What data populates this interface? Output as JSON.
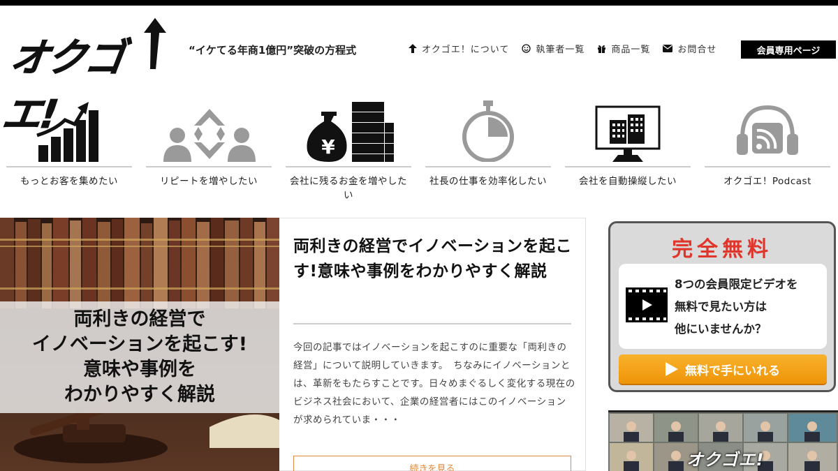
{
  "brand": {
    "logo_text": "オクゴエ!",
    "tagline": "“イケてる年商1億円”突破の方程式"
  },
  "nav": {
    "items": [
      {
        "label": "オクゴエ！について",
        "icon": "arrow-up-icon"
      },
      {
        "label": "執筆者一覧",
        "icon": "smile-icon"
      },
      {
        "label": "商品一覧",
        "icon": "gift-icon"
      },
      {
        "label": "お問合せ",
        "icon": "envelope-icon"
      }
    ],
    "member_button": "会員専用ページ"
  },
  "categories": [
    {
      "label": "もっとお客を集めたい",
      "icon": "growth-chart-icon"
    },
    {
      "label": "リピートを増やしたい",
      "icon": "repeat-customers-icon"
    },
    {
      "label": "会社に残るお金を増やしたい",
      "icon": "yen-money-bag-icon"
    },
    {
      "label": "社長の仕事を効率化したい",
      "icon": "stopwatch-icon"
    },
    {
      "label": "会社を自動操縦したい",
      "icon": "building-monitor-icon"
    },
    {
      "label": "オクゴエ！Podcast",
      "icon": "podcast-headphones-icon"
    }
  ],
  "article": {
    "image_caption_lines": [
      "両利きの経営で",
      "イノベーションを起こす!",
      "意味や事例を",
      "わかりやすく解説"
    ],
    "title": "両利きの経営でイノベーションを起こす!意味や事例をわかりやすく解説",
    "excerpt": "今回の記事ではイノベーションを起こすのに重要な「両利きの経営」について説明していきます。　ちなみにイノベーションとは、革新をもたらすことです。日々めまぐるしく変化する現在のビジネス社会において、企業の経営者にはこのイノベーションが求められていま・・・",
    "read_more": "続きを見る"
  },
  "promo": {
    "title": "完全無料",
    "lines": [
      "8つの会員限定ビデオを",
      "無料で見たい方は",
      "他にいませんか？"
    ],
    "cta": "無料で手にいれる"
  },
  "video_banner": {
    "label": "オクゴエ!"
  },
  "colors": {
    "accent_red": "#e0352b",
    "cta_orange": "#f2a01a",
    "readmore_orange": "#e58a3a"
  }
}
